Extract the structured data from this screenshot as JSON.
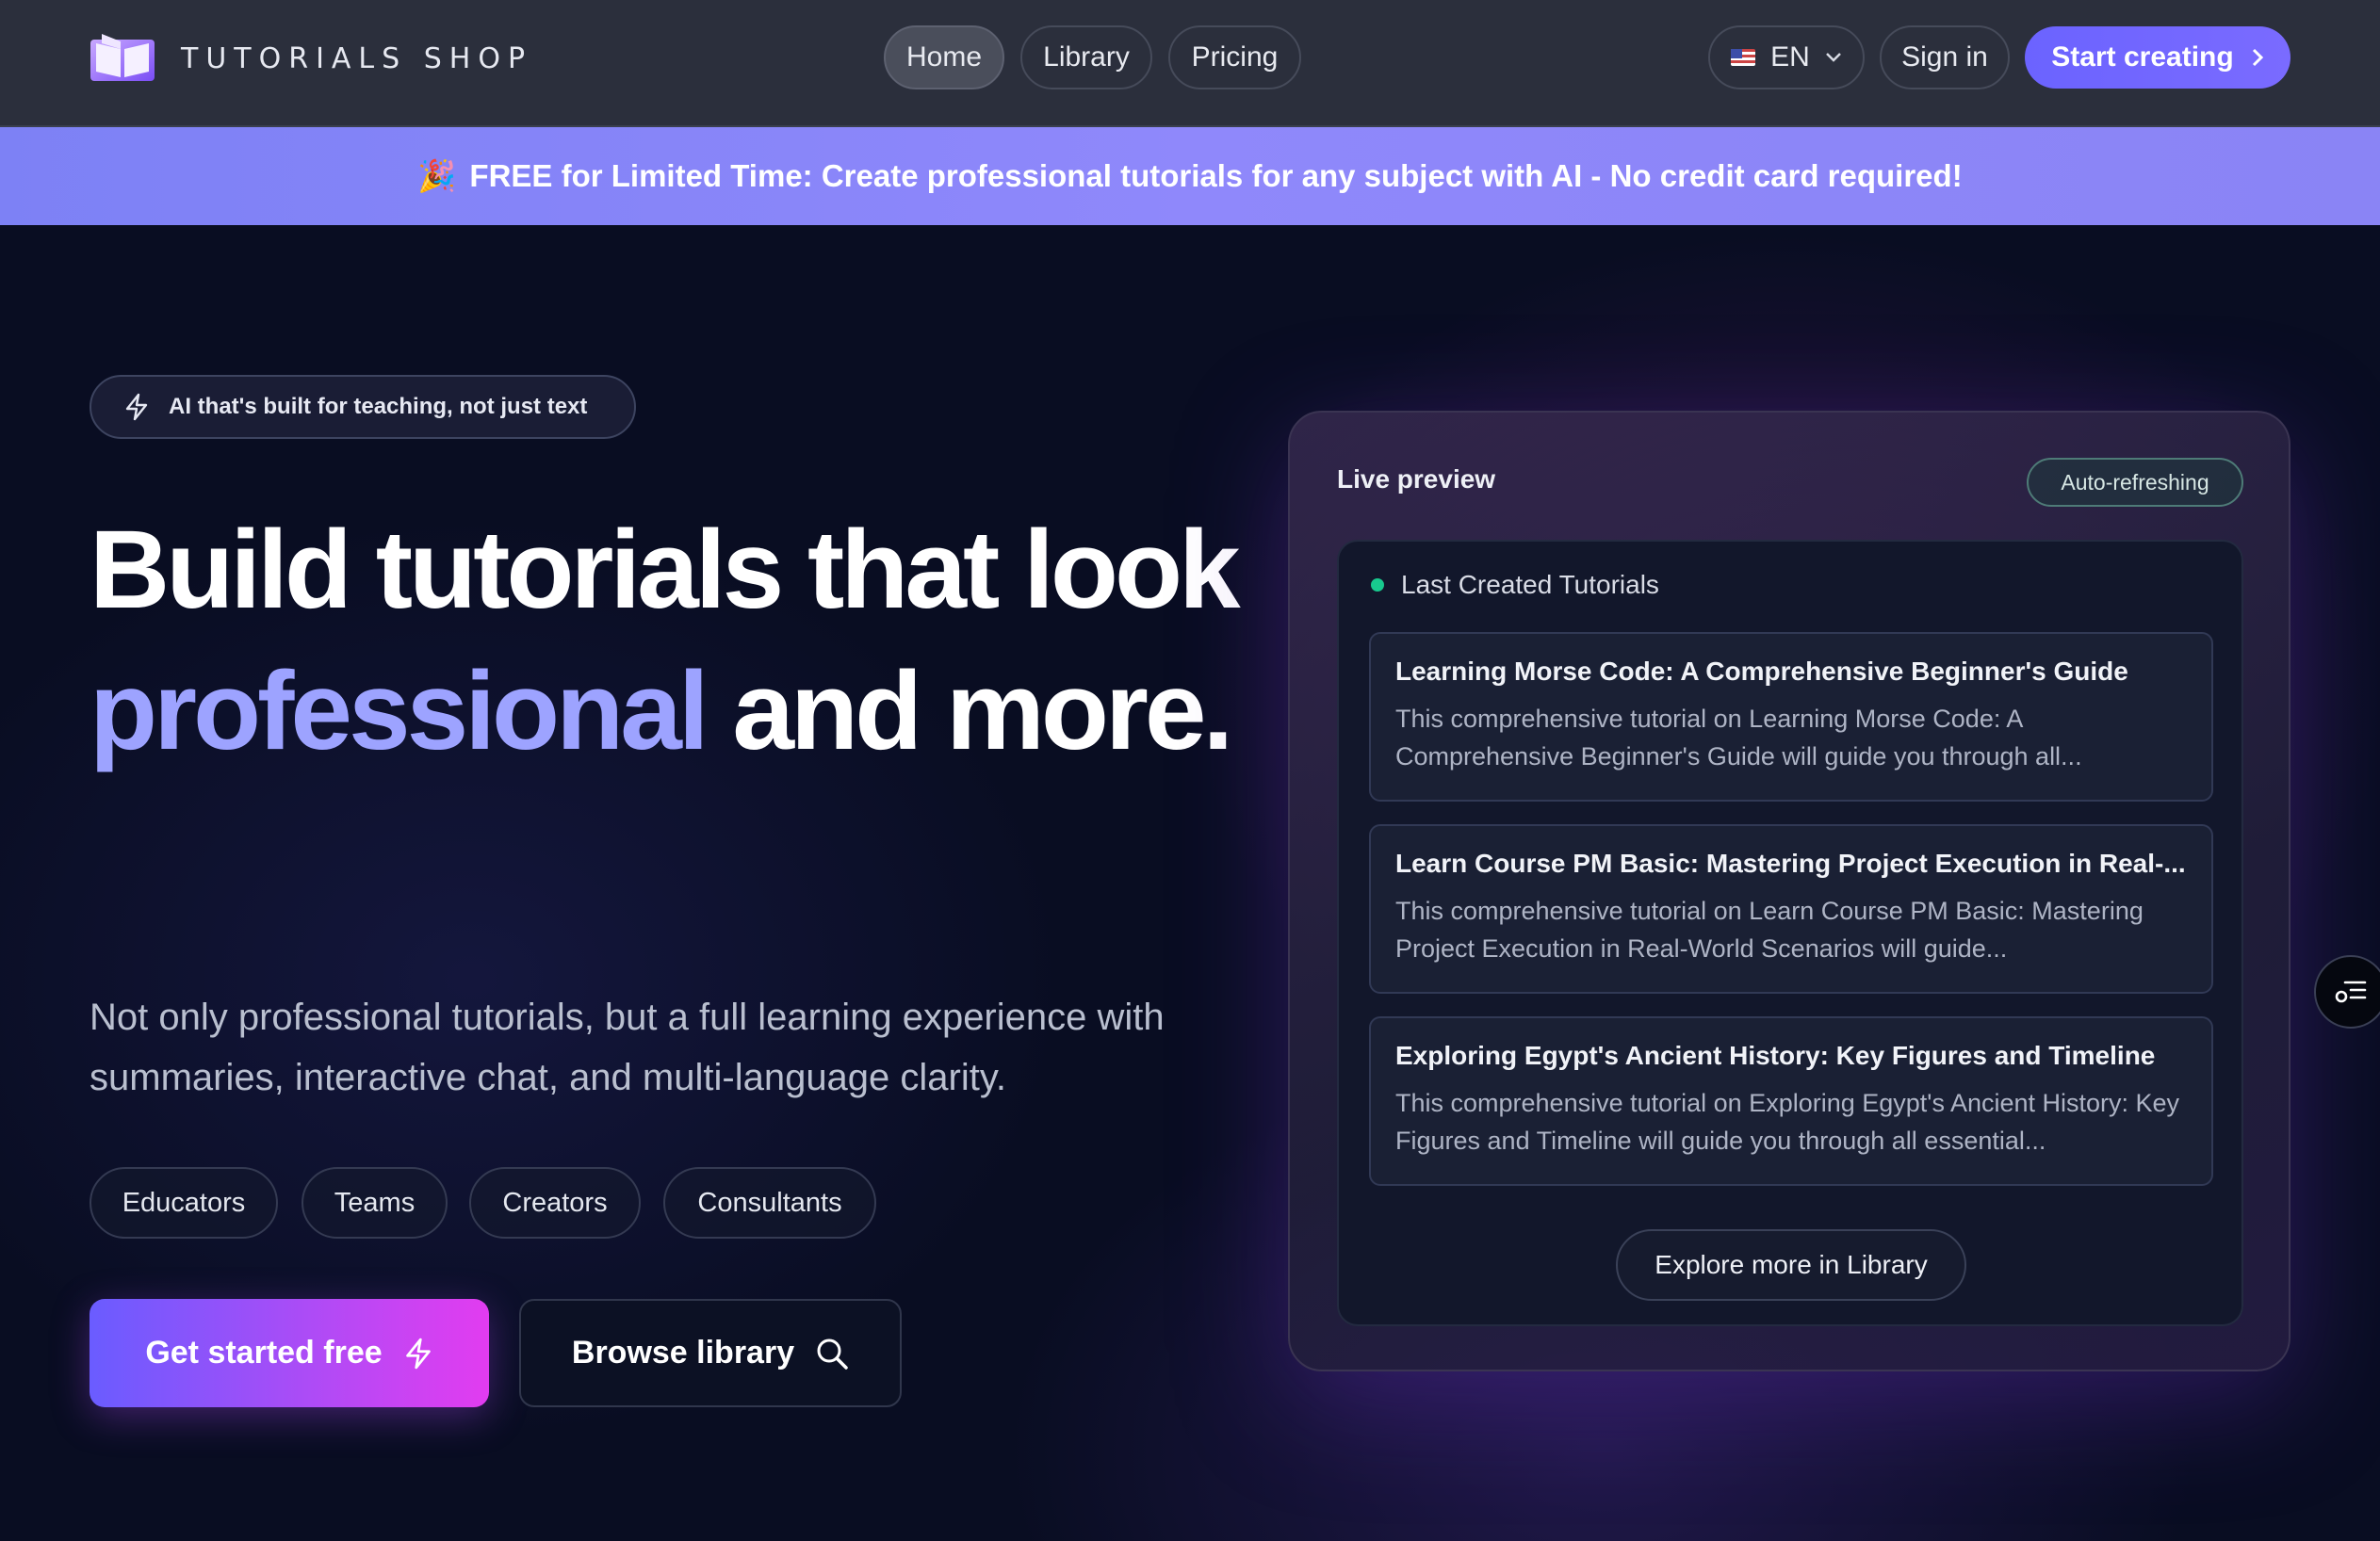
{
  "app": {
    "logo_text": "TUTORIALS SHOP"
  },
  "nav": {
    "items": [
      {
        "label": "Home",
        "active": true
      },
      {
        "label": "Library",
        "active": false
      },
      {
        "label": "Pricing",
        "active": false
      }
    ],
    "language": "EN",
    "sign_in": "Sign in",
    "start_creating": "Start creating"
  },
  "banner": {
    "emoji": "🎉",
    "text": "FREE for Limited Time: Create professional tutorials for any subject with AI - No credit card required!"
  },
  "hero": {
    "chip": "AI that's built for teaching, not just text",
    "headline_part1": "Build tutorials that look",
    "headline_accent": "professional",
    "headline_part2": "and more.",
    "subtext": "Not only professional tutorials, but a full learning experience with summaries, interactive chat, and multi-language clarity.",
    "audiences": [
      "Educators",
      "Teams",
      "Creators",
      "Consultants"
    ],
    "cta_primary": "Get started free",
    "cta_secondary": "Browse library"
  },
  "preview": {
    "title": "Live preview",
    "status": "Auto-refreshing",
    "list_heading": "Last Created Tutorials",
    "tutorials": [
      {
        "title": "Learning Morse Code: A Comprehensive Beginner's Guide",
        "description": "This comprehensive tutorial on Learning Morse Code: A Comprehensive Beginner's Guide will guide you through all..."
      },
      {
        "title": "Learn Course PM Basic: Mastering Project Execution in Real-...",
        "description": "This comprehensive tutorial on Learn Course PM Basic: Mastering Project Execution in Real-World Scenarios will guide..."
      },
      {
        "title": "Exploring Egypt's Ancient History: Key Figures and Timeline",
        "description": "This comprehensive tutorial on Exploring Egypt's Ancient History: Key Figures and Timeline will guide you through all essential..."
      }
    ],
    "explore_button": "Explore more in Library"
  },
  "colors": {
    "accent": "#6b63ff",
    "headline_accent": "#9da3ff",
    "live_dot": "#18c98e",
    "banner": "#8a86f7"
  },
  "icons": {
    "logo": "open-book-icon",
    "flag": "us-flag-icon",
    "chevron": "chevron-down-icon",
    "arrow": "chevron-right-icon",
    "bolt": "lightning-icon",
    "search": "search-icon",
    "floating": "settings-list-icon"
  }
}
